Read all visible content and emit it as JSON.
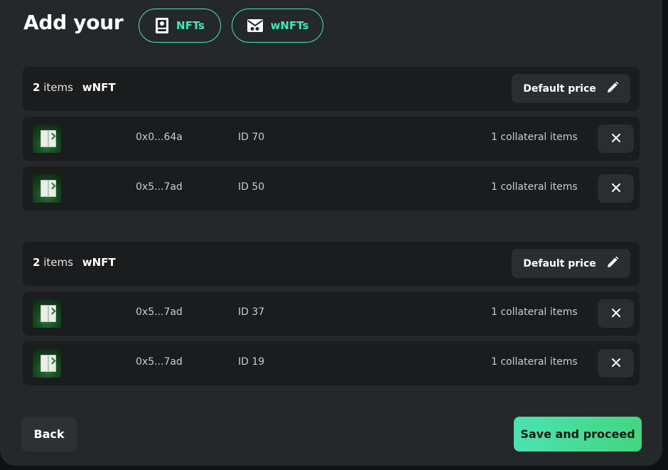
{
  "header": {
    "title": "Add your",
    "tabs": [
      {
        "label": "NFTs",
        "icon": "nft-card-icon"
      },
      {
        "label": "wNFTs",
        "icon": "wnft-envelope-icon"
      }
    ]
  },
  "groups": [
    {
      "count": "2",
      "count_suffix": "items",
      "kind": "wNFT",
      "default_price_label": "Default price",
      "rows": [
        {
          "address": "0x0...64a",
          "id": "ID 70",
          "collateral": "1 collateral items"
        },
        {
          "address": "0x5...7ad",
          "id": "ID 50",
          "collateral": "1 collateral items"
        }
      ]
    },
    {
      "count": "2",
      "count_suffix": "items",
      "kind": "wNFT",
      "default_price_label": "Default price",
      "rows": [
        {
          "address": "0x5...7ad",
          "id": "ID 37",
          "collateral": "1 collateral items"
        },
        {
          "address": "0x5...7ad",
          "id": "ID 19",
          "collateral": "1 collateral items"
        }
      ]
    }
  ],
  "footer": {
    "back_label": "Back",
    "save_label": "Save and proceed"
  },
  "colors": {
    "accent": "#46e8b6",
    "panel": "#25282b",
    "row": "#1a1c1e",
    "button": "#2b2e31"
  }
}
